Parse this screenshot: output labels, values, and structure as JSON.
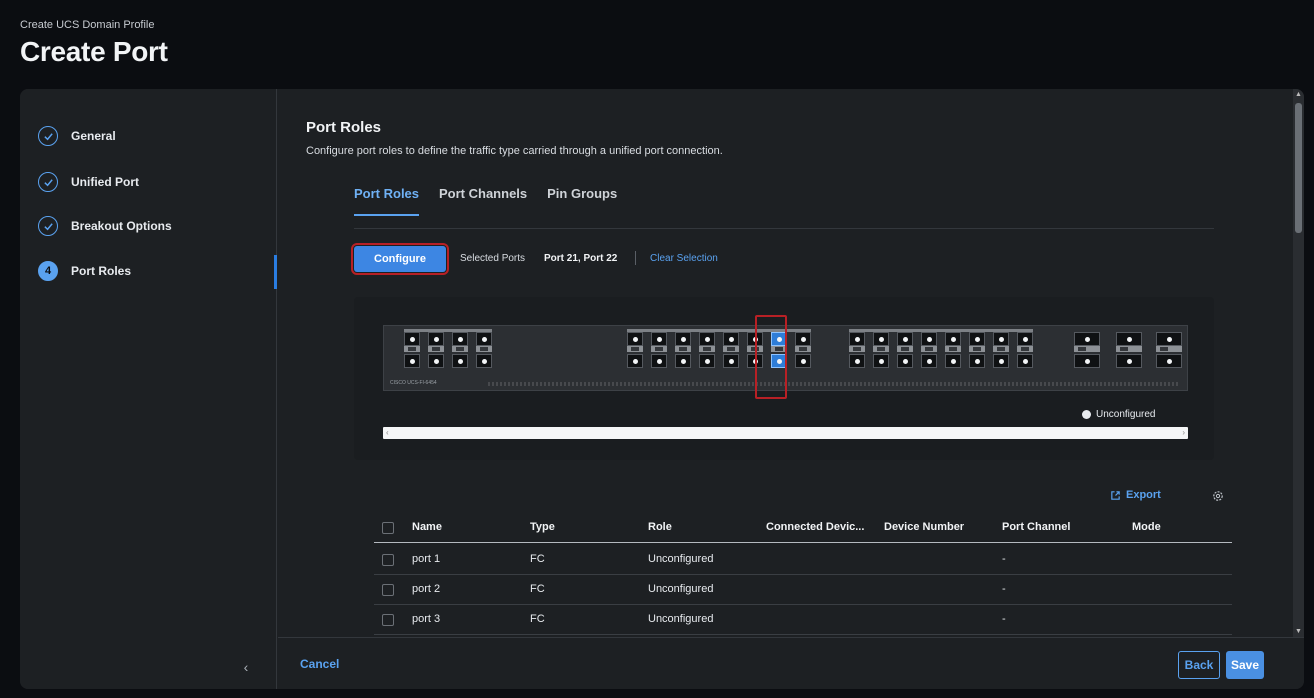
{
  "header": {
    "breadcrumb": "Create UCS Domain Profile",
    "title": "Create Port"
  },
  "sidebar": {
    "steps": [
      {
        "label": "General",
        "state": "done"
      },
      {
        "label": "Unified Port",
        "state": "done"
      },
      {
        "label": "Breakout Options",
        "state": "done"
      },
      {
        "label": "Port Roles",
        "state": "active",
        "number": "4"
      }
    ],
    "collapse_icon": "chevron-left-icon"
  },
  "section": {
    "title": "Port Roles",
    "description": "Configure port roles to define the traffic type carried through a unified port connection."
  },
  "tabs": [
    {
      "label": "Port Roles",
      "active": true
    },
    {
      "label": "Port Channels",
      "active": false
    },
    {
      "label": "Pin Groups",
      "active": false
    }
  ],
  "toolbar": {
    "configure_label": "Configure",
    "selected_ports_label": "Selected Ports",
    "selected_ports_value": "Port 21, Port 22",
    "clear_selection_label": "Clear Selection"
  },
  "switch": {
    "model_label": "CISCO UCS-FI-6454",
    "selected_ports": [
      21,
      22
    ],
    "legend": "Unconfigured"
  },
  "table": {
    "export_label": "Export",
    "columns": [
      "Name",
      "Type",
      "Role",
      "Connected Devic...",
      "Device Number",
      "Port Channel",
      "Mode"
    ],
    "rows": [
      {
        "name": "port 1",
        "type": "FC",
        "role": "Unconfigured",
        "connected": "",
        "device_number": "",
        "port_channel": "-",
        "mode": ""
      },
      {
        "name": "port 2",
        "type": "FC",
        "role": "Unconfigured",
        "connected": "",
        "device_number": "",
        "port_channel": "-",
        "mode": ""
      },
      {
        "name": "port 3",
        "type": "FC",
        "role": "Unconfigured",
        "connected": "",
        "device_number": "",
        "port_channel": "-",
        "mode": ""
      }
    ]
  },
  "footer": {
    "cancel_label": "Cancel",
    "back_label": "Back",
    "save_label": "Save"
  },
  "colors": {
    "accent": "#5aa2f0",
    "primary_button": "#3d86e3",
    "highlight_box": "#b82025",
    "background": "#0b0d11",
    "panel": "#1d2023"
  }
}
